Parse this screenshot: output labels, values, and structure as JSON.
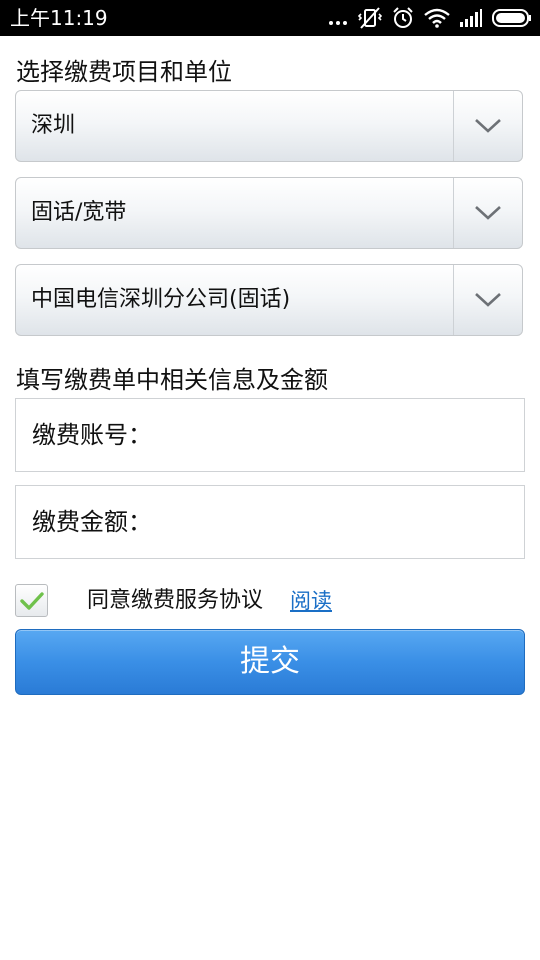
{
  "status_bar": {
    "time": "上午11:19",
    "icons": [
      "more-dots-icon",
      "vibrate-icon",
      "alarm-icon",
      "wifi-icon",
      "signal-icon",
      "battery-icon"
    ]
  },
  "form": {
    "section1_title": "选择缴费项目和单位",
    "selects": [
      {
        "value": "深圳"
      },
      {
        "value": "固话/宽带"
      },
      {
        "value": "中国电信深圳分公司(固话)"
      }
    ],
    "section2_title": "填写缴费单中相关信息及金额",
    "inputs": [
      {
        "label": "缴费账号："
      },
      {
        "label": "缴费金额："
      }
    ],
    "agreement": {
      "checked": true,
      "text": "同意缴费服务协议",
      "link": "阅读"
    },
    "submit_label": "提交"
  },
  "colors": {
    "status_bar": "#000000",
    "primary_button": "#3a8fe6",
    "link": "#1a6fc6",
    "checkmark": "#6fc14b"
  }
}
